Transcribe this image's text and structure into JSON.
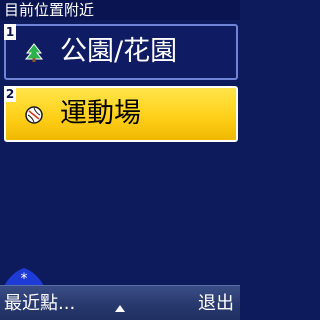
{
  "header": {
    "title": "目前位置附近"
  },
  "list": {
    "items": [
      {
        "index": "1",
        "label": "公園/花園",
        "icon": "tree-icon",
        "selected": false
      },
      {
        "index": "2",
        "label": "運動場",
        "icon": "sports-ball-icon",
        "selected": true
      }
    ]
  },
  "softkeys": {
    "left_label": "最近點...",
    "center_icon": "up-arrow-icon",
    "right_label": "退出"
  },
  "colors": {
    "background": "#0d1a5c",
    "highlight": "#ffd01a",
    "softbar": "#28396e"
  }
}
